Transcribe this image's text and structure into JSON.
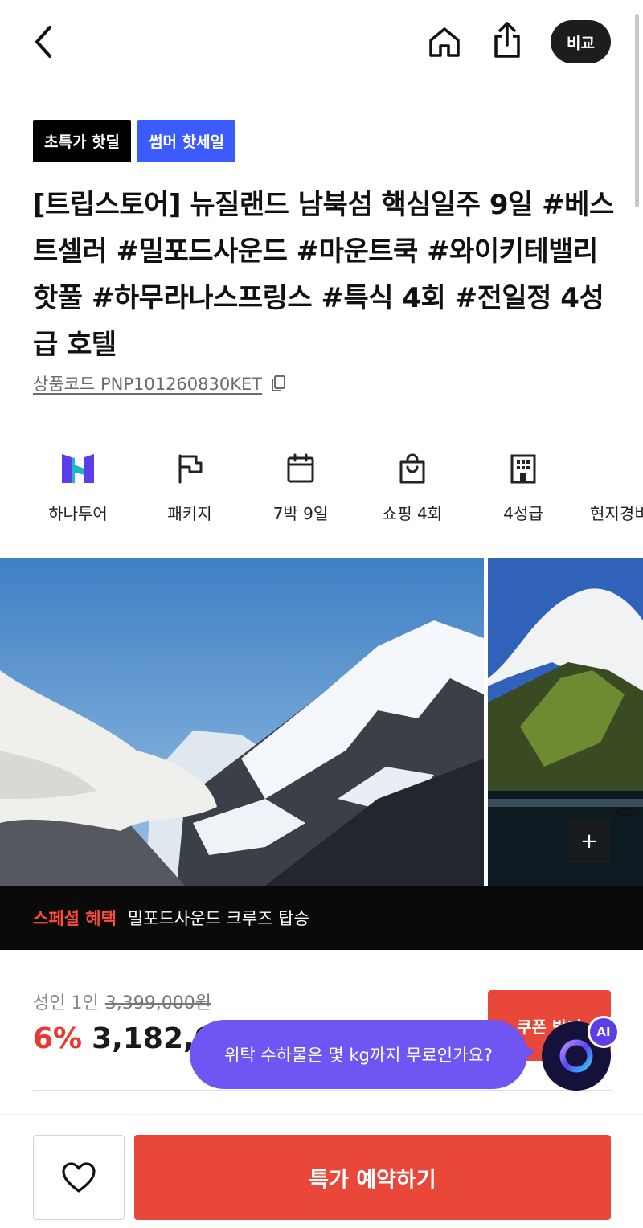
{
  "header": {
    "back_icon": "chevron-left-icon",
    "home_icon": "home-icon",
    "share_icon": "share-icon",
    "compare_label": "비교"
  },
  "badges": [
    "초특가 핫딜",
    "썸머 핫세일"
  ],
  "product": {
    "title": "[트립스토어] 뉴질랜드 남북섬 핵심일주 9일 #베스트셀러 #밀포드사운드 #마운트쿡 #와이키테밸리핫풀 #하무라나스프링스 #특식 4회 #전일정 4성급 호텔",
    "code": "상품코드 PNP101260830KET"
  },
  "features": [
    {
      "icon": "hanatour-logo-icon",
      "label": "하나투어"
    },
    {
      "icon": "flag-icon",
      "label": "패키지"
    },
    {
      "icon": "calendar-icon",
      "label": "7박 9일"
    },
    {
      "icon": "shopping-bag-icon",
      "label": "쇼핑 4회"
    },
    {
      "icon": "building-icon",
      "label": "4성급"
    },
    {
      "icon": "",
      "label": "현지경비"
    }
  ],
  "gallery": {
    "more_icon": "plus-icon",
    "more_label": "+"
  },
  "special": {
    "label": "스페셜 혜택",
    "text": "밀포드사운드 크루즈 탑승"
  },
  "price": {
    "person": "성인 1인",
    "original": "3,399,000원",
    "discount": "6%",
    "current": "3,182,0"
  },
  "coupon": {
    "label": "쿠폰 받기"
  },
  "ai": {
    "question": "위탁 수하물은 몇 kg까지 무료인가요?",
    "badge": "AI"
  },
  "bottom": {
    "wish_icon": "heart-icon",
    "book_label": "특가 예약하기"
  },
  "colors": {
    "accent_red": "#e8473a",
    "badge_blue": "#3b5bfd",
    "ai_purple": "#6f55f2"
  }
}
